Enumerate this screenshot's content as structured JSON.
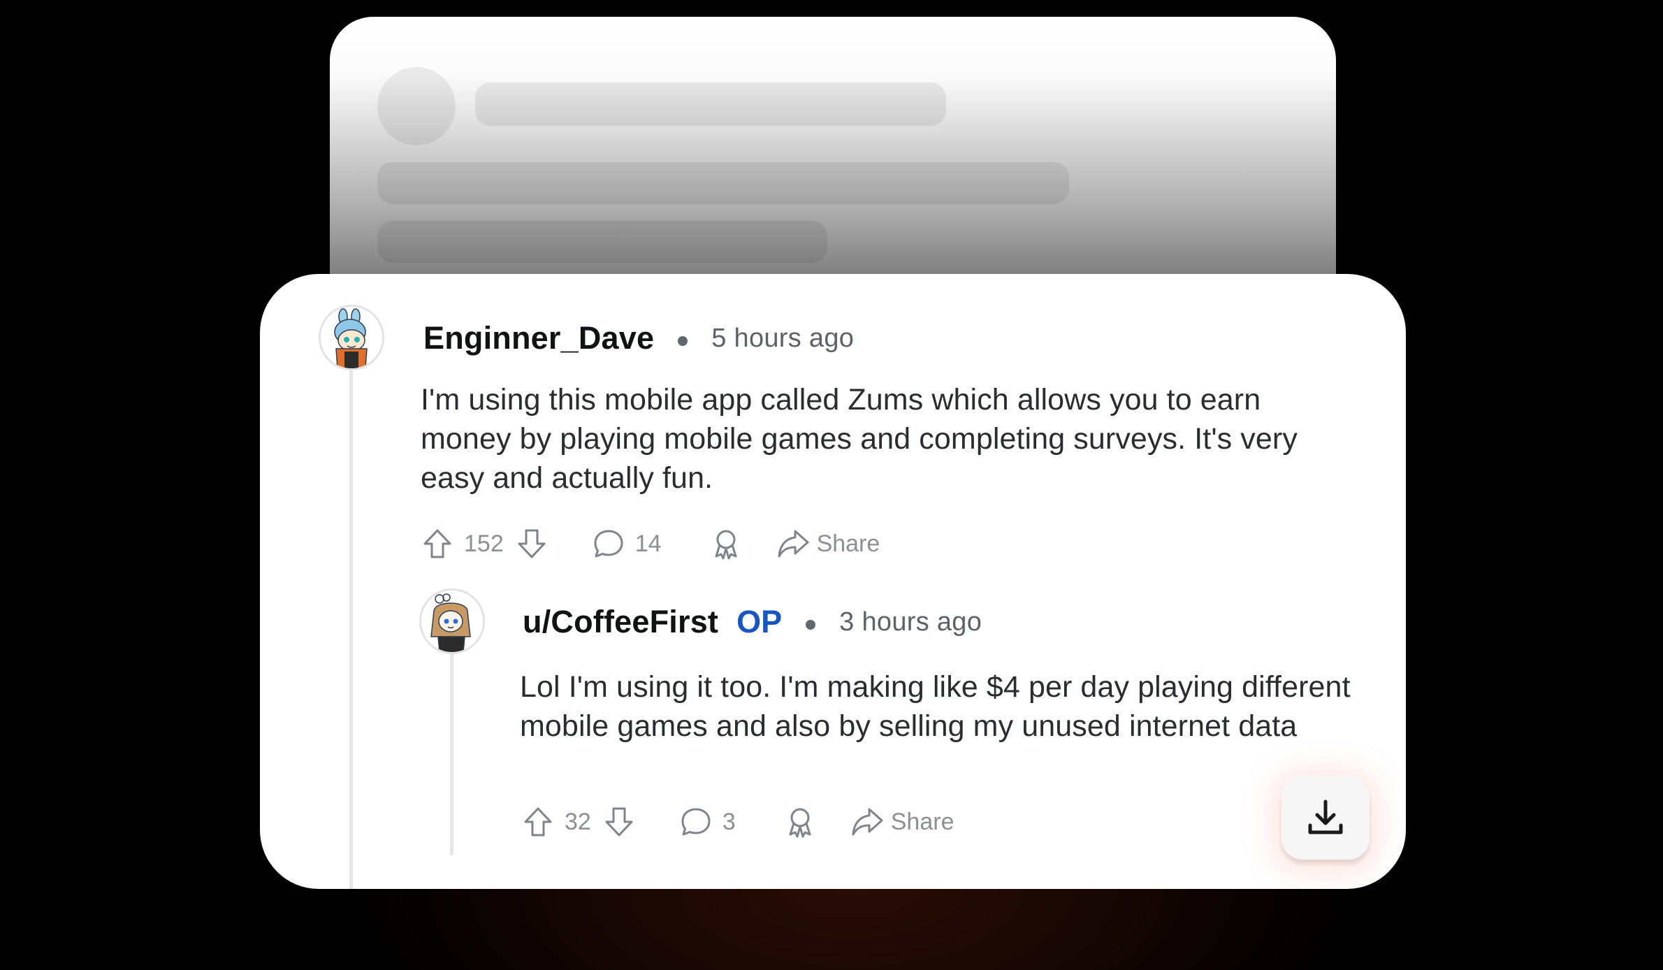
{
  "comments": [
    {
      "username": "Enginner_Dave",
      "timestamp": "5 hours ago",
      "body": "I'm using this mobile app called Zums which allows you to earn money by playing mobile games and completing surveys. It's very easy and actually fun.",
      "upvotes": "152",
      "replies": "14",
      "share_label": "Share"
    },
    {
      "username": "u/CoffeeFirst",
      "badge": "OP",
      "timestamp": "3 hours ago",
      "body": "Lol I'm using it too. I'm making like $4 per day playing different mobile games and also by selling my unused internet data",
      "upvotes": "32",
      "replies": "3",
      "share_label": "Share"
    }
  ],
  "icons": {
    "upvote": "arrow-up-outline-icon",
    "downvote": "arrow-down-outline-icon",
    "comment": "speech-bubble-icon",
    "award": "award-ribbon-icon",
    "share": "share-arrow-icon",
    "download": "download-icon"
  },
  "colors": {
    "op_badge": "#1656c4",
    "meta_text": "#5c6268",
    "action_text": "#8a9096"
  }
}
